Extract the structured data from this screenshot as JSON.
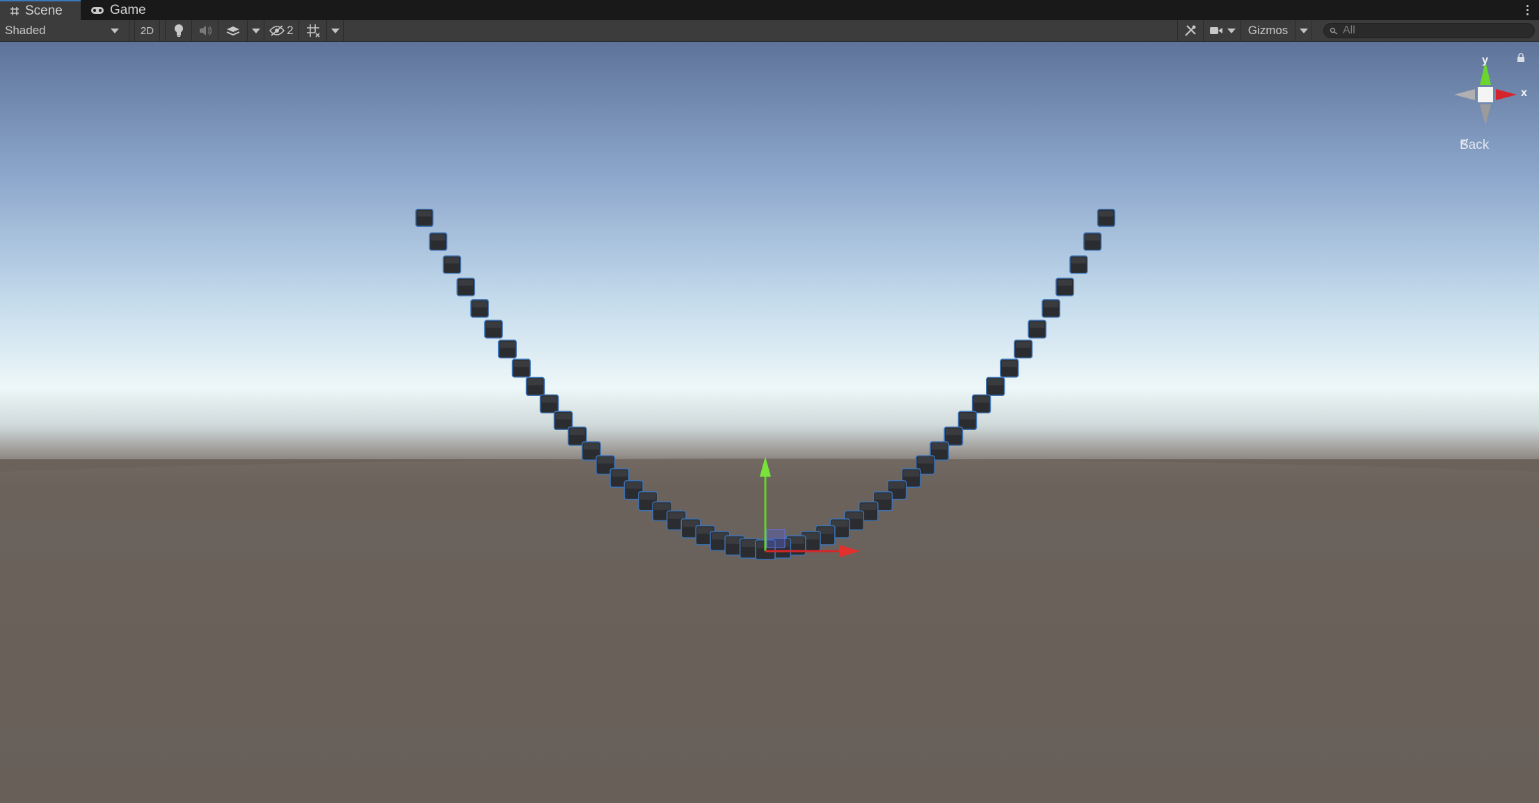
{
  "tabs": [
    {
      "label": "Scene",
      "icon": "hash-grid-icon",
      "active": true
    },
    {
      "label": "Game",
      "icon": "gamepad-icon",
      "active": false
    }
  ],
  "toolbar": {
    "shading_mode": "Shaded",
    "mode_2d_label": "2D",
    "hidden_count": "2",
    "gizmos_label": "Gizmos",
    "search_placeholder": "All"
  },
  "orientation_gizmo": {
    "y_label": "y",
    "x_label": "x",
    "view_label": "Back"
  },
  "colors": {
    "accent": "#3a79bb",
    "axis_x": "#d4262b",
    "axis_y": "#63d32c",
    "cube": "#2b2c2f",
    "cube_outline": "#3e73b4"
  },
  "scene": {
    "chain_links_per_side": 24,
    "object": "chain of dark cubes hanging in a U-shaped catenary"
  }
}
